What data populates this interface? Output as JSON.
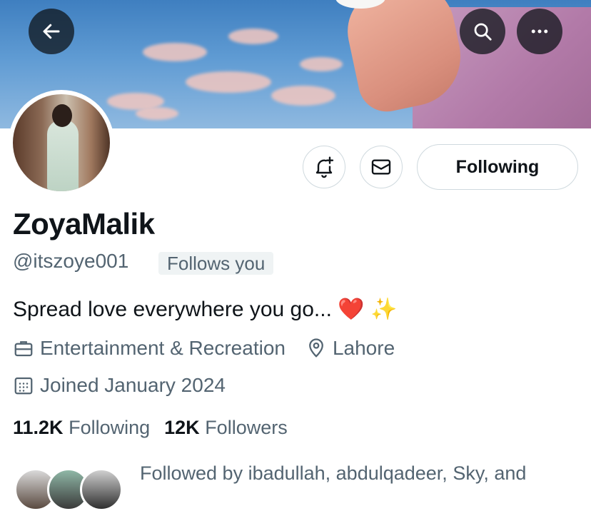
{
  "header": {
    "back_icon": "arrow-left-icon",
    "search_icon": "search-icon",
    "more_icon": "more-horizontal-icon"
  },
  "actions": {
    "notify_icon": "bell-plus-icon",
    "message_icon": "envelope-icon",
    "following_label": "Following"
  },
  "profile": {
    "display_name": "ZoyaMalik",
    "handle": "@itszoye001",
    "follows_you_badge": "Follows you",
    "bio_text": "Spread love everywhere you go...",
    "bio_emoji_heart": "❤️",
    "bio_emoji_sparkles": "✨",
    "category": "Entertainment & Recreation",
    "location": "Lahore",
    "joined": "Joined January 2024"
  },
  "stats": {
    "following_count": "11.2K",
    "following_label": "Following",
    "followers_count": "12K",
    "followers_label": "Followers"
  },
  "followed_by": {
    "text": "Followed by ibadullah, abdulqadeer, Sky, and"
  },
  "colors": {
    "text_primary": "#0f1419",
    "text_secondary": "#536471",
    "border": "#cfd9de",
    "badge_bg": "#eff3f4"
  }
}
